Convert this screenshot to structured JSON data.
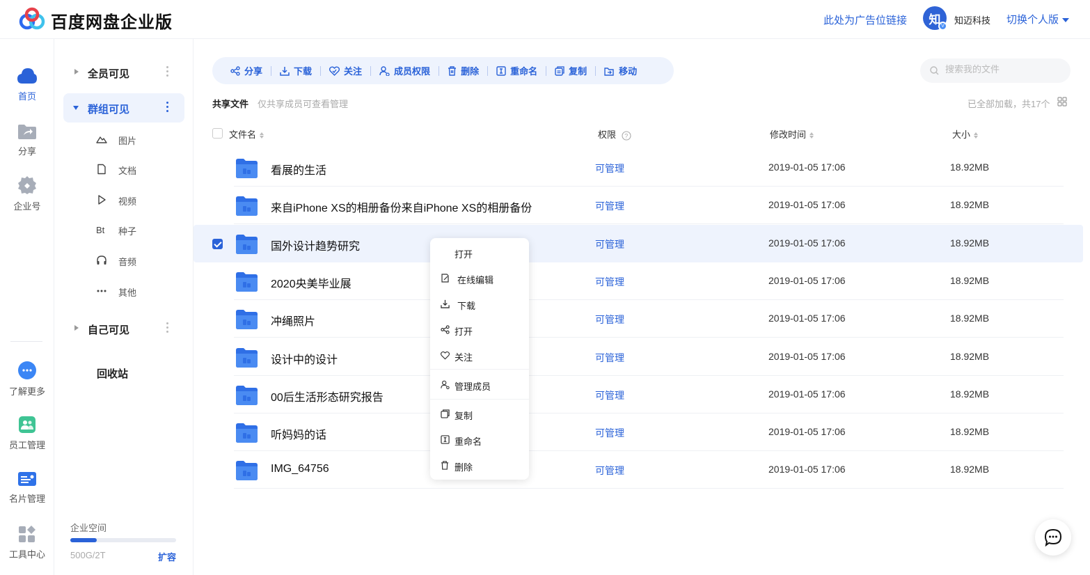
{
  "header": {
    "brand": "百度网盘企业版",
    "ad_link": "此处为广告位链接",
    "avatar_text": "知",
    "company": "知迈科技",
    "switch_label": "切换个人版"
  },
  "rail": {
    "items": [
      {
        "label": "首页",
        "icon": "cloud-icon",
        "active": true
      },
      {
        "label": "分享",
        "icon": "share-folder-icon"
      },
      {
        "label": "企业号",
        "icon": "enterprise-gear-icon"
      },
      {
        "label": "了解更多",
        "icon": "more-bubble-icon"
      },
      {
        "label": "员工管理",
        "icon": "staff-icon"
      },
      {
        "label": "名片管理",
        "icon": "card-icon"
      },
      {
        "label": "工具中心",
        "icon": "tools-icon"
      }
    ]
  },
  "nav": {
    "groups": [
      {
        "label": "全员可见"
      },
      {
        "label": "群组可见"
      },
      {
        "label": "自己可见"
      }
    ],
    "sub_items": [
      {
        "label": "图片",
        "icon": "picture-icon"
      },
      {
        "label": "文档",
        "icon": "document-icon"
      },
      {
        "label": "视频",
        "icon": "video-icon"
      },
      {
        "label": "种子",
        "icon": "torrent-icon"
      },
      {
        "label": "音频",
        "icon": "audio-icon"
      },
      {
        "label": "其他",
        "icon": "other-icon"
      }
    ],
    "recycle": "回收站",
    "space": {
      "label": "企业空间",
      "used_text": "500G/2T",
      "used_fraction": 0.25,
      "expand_label": "扩容"
    }
  },
  "toolbar": {
    "buttons": [
      {
        "label": "分享",
        "icon": "share-icon"
      },
      {
        "label": "下载",
        "icon": "download-icon"
      },
      {
        "label": "关注",
        "icon": "follow-icon"
      },
      {
        "label": "成员权限",
        "icon": "member-icon"
      },
      {
        "label": "删除",
        "icon": "trash-icon"
      },
      {
        "label": "重命名",
        "icon": "rename-icon"
      },
      {
        "label": "复制",
        "icon": "copy-icon"
      },
      {
        "label": "移动",
        "icon": "move-icon"
      }
    ],
    "search_placeholder": "搜索我的文件"
  },
  "list": {
    "title": "共享文件",
    "subtitle": "仅共享成员可查看管理",
    "loaded_text": "已全部加载，共17个",
    "columns": {
      "name": "文件名",
      "perm": "权限",
      "time": "修改时间",
      "size": "大小"
    },
    "rows": [
      {
        "name": "看展的生活",
        "perm": "可管理",
        "time": "2019-01-05 17:06",
        "size": "18.92MB",
        "selected": false
      },
      {
        "name": "来自iPhone XS的相册备份来自iPhone XS的相册备份",
        "perm": "可管理",
        "time": "2019-01-05 17:06",
        "size": "18.92MB",
        "selected": false
      },
      {
        "name": "国外设计趋势研究",
        "perm": "可管理",
        "time": "2019-01-05 17:06",
        "size": "18.92MB",
        "selected": true
      },
      {
        "name": "2020央美毕业展",
        "perm": "可管理",
        "time": "2019-01-05 17:06",
        "size": "18.92MB",
        "selected": false
      },
      {
        "name": "冲绳照片",
        "perm": "可管理",
        "time": "2019-01-05 17:06",
        "size": "18.92MB",
        "selected": false
      },
      {
        "name": "设计中的设计",
        "perm": "可管理",
        "time": "2019-01-05 17:06",
        "size": "18.92MB",
        "selected": false
      },
      {
        "name": "00后生活形态研究报告",
        "perm": "可管理",
        "time": "2019-01-05 17:06",
        "size": "18.92MB",
        "selected": false
      },
      {
        "name": "听妈妈的话",
        "perm": "可管理",
        "time": "2019-01-05 17:06",
        "size": "18.92MB",
        "selected": false
      },
      {
        "name": "IMG_64756",
        "perm": "可管理",
        "time": "2019-01-05 17:06",
        "size": "18.92MB",
        "selected": false
      }
    ]
  },
  "context_menu": {
    "items": [
      {
        "label": "打开",
        "icon": ""
      },
      {
        "label": "在线编辑",
        "icon": "edit-icon"
      },
      {
        "label": "下载",
        "icon": "download-icon"
      },
      {
        "label": "打开",
        "icon": "share-icon"
      },
      {
        "label": "关注",
        "icon": "follow-icon"
      },
      {
        "label": "管理成员",
        "icon": "member-icon"
      },
      {
        "label": "复制",
        "icon": "copy-icon"
      },
      {
        "label": "重命名",
        "icon": "rename-icon"
      },
      {
        "label": "删除",
        "icon": "trash-icon"
      }
    ]
  },
  "colors": {
    "accent": "#2a62d8",
    "selected_row": "#eef3fd"
  }
}
